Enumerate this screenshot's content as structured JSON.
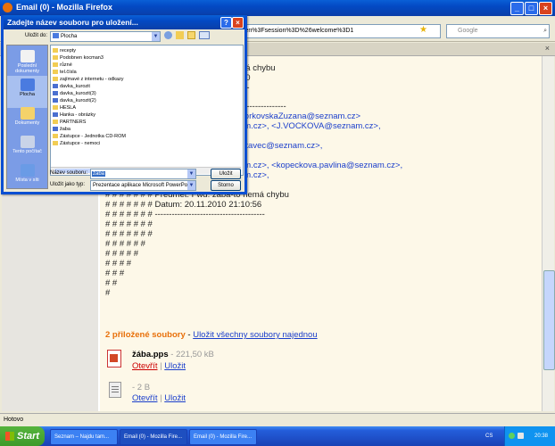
{
  "firefox": {
    "title": "Email (0) - Mozilla Firefox",
    "url_fragment": "ven%3Fsession%3D%26welcome%3D1",
    "search_placeholder": "Google",
    "status_text": "Hotovo"
  },
  "message": {
    "lines": [
      {
        "text": "ná chybu",
        "link": false
      },
      {
        "text": "50",
        "link": false
      },
      {
        "text": "---",
        "link": false
      },
      {
        "text": "----------------",
        "link": false
      },
      {
        "text": "VorkovskaZuzana@seznam.cz>",
        "link": true
      },
      {
        "text": "am.cz>, <J.VOCKOVA@seznam.cz>,",
        "link": true
      },
      {
        "text": "ditavec@seznam.cz>,",
        "link": true
      },
      {
        "text": "am.cz>, <kopeckova.pavlina@seznam.cz>,",
        "link": true
      },
      {
        "text": "am.cz>,",
        "link": true
      },
      {
        "text": "# # # # # # # Předmět: Fwd: žába-to nemá chybu",
        "link": false
      },
      {
        "text": "# # # # # # # Datum: 20.11.2010 21:10:56",
        "link": false
      },
      {
        "text": "# # # # # # # ---------------------------------------",
        "link": false
      },
      {
        "text": "# # # # # # #",
        "link": false
      },
      {
        "text": "# # # # # # #",
        "link": false
      },
      {
        "text": "# # # # # #",
        "link": false
      },
      {
        "text": "# # # # #",
        "link": false
      },
      {
        "text": "# # # #",
        "link": false
      },
      {
        "text": "# # #",
        "link": false
      },
      {
        "text": "# #",
        "link": false
      },
      {
        "text": "#",
        "link": false
      }
    ],
    "attachments_title": "2 přiložené soubory",
    "attachments_sep": " - ",
    "save_all": "Uložit všechny soubory najednou",
    "attachments": [
      {
        "name": "žába.pps",
        "size": " - 221,50 kB",
        "open": "Otevřít",
        "save": "Uložit"
      },
      {
        "name": "",
        "size": "- 2 B",
        "open": "Otevřít",
        "save": "Uložit"
      }
    ],
    "sep": "|"
  },
  "dialog": {
    "title": "Zadejte název souboru pro uložení...",
    "save_in_label": "Uložit do:",
    "save_in_value": "Plocha",
    "places": [
      "Poslední dokumenty",
      "Plocha",
      "Dokumenty",
      "Tento počítač",
      "Místa v síti"
    ],
    "files": [
      "recepty",
      "Podobnen kocman3",
      "různé",
      "tel.čísla",
      "zajímavé z internetu - odkazy",
      "davka_kurozit",
      "davka_kurozit(3)",
      "davka_kurozit(2)",
      "HESLA",
      "Hanka - obrázky",
      "PARTNERS",
      "žaba",
      "Zástupce - Jednotka CD-ROM",
      "Zástupce - nemoci"
    ],
    "filename_label": "Název souboru:",
    "filename_value": "žaba",
    "filetype_label": "Uložit jako typ:",
    "filetype_value": "Prezentace aplikace Microsoft PowerPoint",
    "save_button": "Uložit",
    "cancel_button": "Storno"
  },
  "taskbar": {
    "start": "Start",
    "tasks": [
      "Seznam – Najdu tam...",
      "Email (0) - Mozilla Fire...",
      "Email (0) - Mozilla Fire..."
    ],
    "lang": "CS",
    "clock": "20:38"
  },
  "colors": {
    "xp_blue": "#0349c3",
    "link": "#1a3ecb",
    "attachment_orange": "#e8700a"
  }
}
